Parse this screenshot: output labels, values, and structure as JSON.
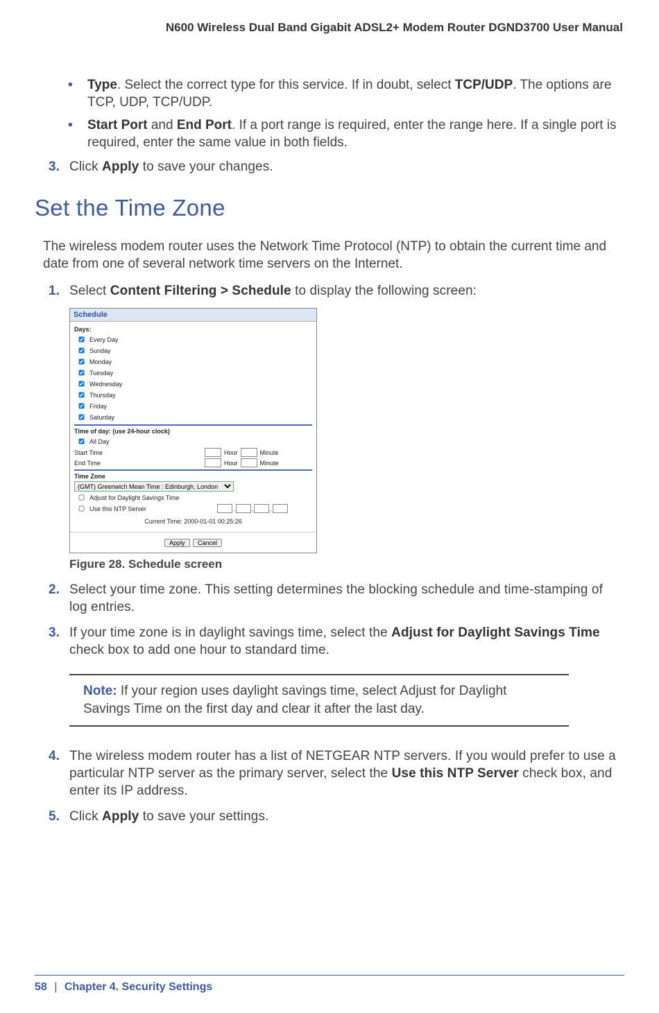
{
  "header": {
    "manual_title": "N600 Wireless Dual Band Gigabit ADSL2+ Modem Router DGND3700 User Manual"
  },
  "bullets": {
    "b1_pre": "Type",
    "b1_rest": ". Select the correct type for this service. If in doubt, select ",
    "b1_bold2": "TCP/UDP",
    "b1_tail": ". The options are TCP, UDP, TCP/UDP.",
    "b2_pre1": "Start Port",
    "b2_mid1": " and ",
    "b2_pre2": "End Port",
    "b2_rest": ". If a port range is required, enter the range here. If a single port is required, enter the same value in both fields."
  },
  "steps_top": {
    "s3_num": "3.",
    "s3_a": "Click ",
    "s3_b": "Apply",
    "s3_c": " to save your changes."
  },
  "heading": "Set the Time Zone",
  "intro": "The wireless modem router uses the Network Time Protocol (NTP) to obtain the current time and date from one of several network time servers on the Internet.",
  "steps": {
    "s1_num": "1.",
    "s1_a": "Select ",
    "s1_b": "Content Filtering > Schedule",
    "s1_c": " to display the following screen:",
    "s2_num": "2.",
    "s2_text": "Select your time zone. This setting determines the blocking schedule and time-stamping of log entries.",
    "s3_num": "3.",
    "s3_a": "If your time zone is in daylight savings time, select the ",
    "s3_b": "Adjust for Daylight Savings Time",
    "s3_c": " check box to add one hour to standard time.",
    "s4_num": "4.",
    "s4_a": "The wireless modem router has a list of NETGEAR NTP servers. If you would prefer to use a particular NTP server as the primary server, select the ",
    "s4_b": "Use this NTP Server",
    "s4_c": " check box, and enter its IP address.",
    "s5_num": "5.",
    "s5_a": "Click ",
    "s5_b": "Apply",
    "s5_c": " to save your settings."
  },
  "figure": {
    "title": "Schedule",
    "days_label": "Days:",
    "days": [
      "Every Day",
      "Sunday",
      "Monday",
      "Tuesday",
      "Wednesday",
      "Thursday",
      "Friday",
      "Saturday"
    ],
    "tod_label": "Time of day: (use 24-hour clock)",
    "all_day": "All Day",
    "start_time": "Start Time",
    "end_time": "End Time",
    "hour": "Hour",
    "minute": "Minute",
    "tz_label": "Time Zone",
    "tz_value": "(GMT) Greenwich Mean Time : Edinburgh, London",
    "adjust": "Adjust for Daylight Savings Time",
    "use_ntp": "Use this NTP Server",
    "current": "Current Time:  2000-01-01 00:25:26",
    "apply": "Apply",
    "cancel": "Cancel",
    "caption": "Figure 28.  Schedule screen"
  },
  "note": {
    "label": "Note:",
    "text": "  If your region uses daylight savings time, select Adjust for Daylight Savings Time on the first day and clear it after the last day."
  },
  "footer": {
    "page": "58",
    "sep": "|",
    "chapter": "Chapter 4.  Security Settings"
  }
}
